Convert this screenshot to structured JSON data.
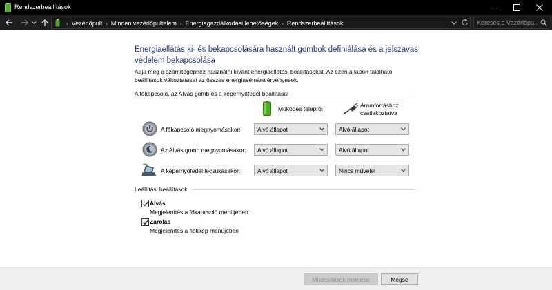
{
  "window": {
    "title": "Rendszerbeállítások",
    "minimize_glyph": "—",
    "maximize_glyph": "☐",
    "close_glyph": "✕"
  },
  "addressbar": {
    "breadcrumbs": [
      "Vezérlőpult",
      "Minden vezérlőpultelem",
      "Energiagazdálkodási lehetőségek",
      "Rendszerbeállítások"
    ],
    "search_placeholder": "Keresés a Vezérlőpu..."
  },
  "content": {
    "heading": "Energiaellátás ki- és bekapcsolására használt gombok definiálása és a jelszavas védelem bekapcsolása",
    "description": "Adja meg a számítógéphez használni kívánt energiaellátási beállításokat. Az ezen a lapon található beállítások változtatásai az összes energiasémára érvényesek.",
    "power_group": {
      "label": "A főkapcsoló, az Alvás gomb és a képernyőfedél beállításai",
      "col_battery": "Működés telepről",
      "col_plugged_line1": "Áramforráshoz",
      "col_plugged_line2": "csatlakoztatva",
      "rows": [
        {
          "label": "A főkapcsoló megnyomásakor:",
          "battery": "Alvó állapot",
          "plugged": "Alvó állapot",
          "icon": "power-button-icon"
        },
        {
          "label": "Az Alvás gomb megnyomásakor:",
          "battery": "Alvó állapot",
          "plugged": "Alvó állapot",
          "icon": "sleep-button-icon"
        },
        {
          "label": "A képernyőfedél lecsukásakor:",
          "battery": "Alvó állapot",
          "plugged": "Nincs művelet",
          "icon": "laptop-lid-icon"
        }
      ]
    },
    "shutdown_group": {
      "label": "Leállítási beállítások",
      "items": [
        {
          "title": "Alvás",
          "description": "Megjelenítés a főkapcsoló menüjében.",
          "checked": true
        },
        {
          "title": "Zárolás",
          "description": "Megjelenítés a fiókkép menüjében",
          "checked": true
        }
      ]
    }
  },
  "footer": {
    "save_label": "Módosítások mentése",
    "cancel_label": "Mégse"
  },
  "colors": {
    "heading": "#1e3287",
    "titlebar": "#000000",
    "addressbar": "#1f1f1f",
    "battery_green": "#4caf1e"
  }
}
